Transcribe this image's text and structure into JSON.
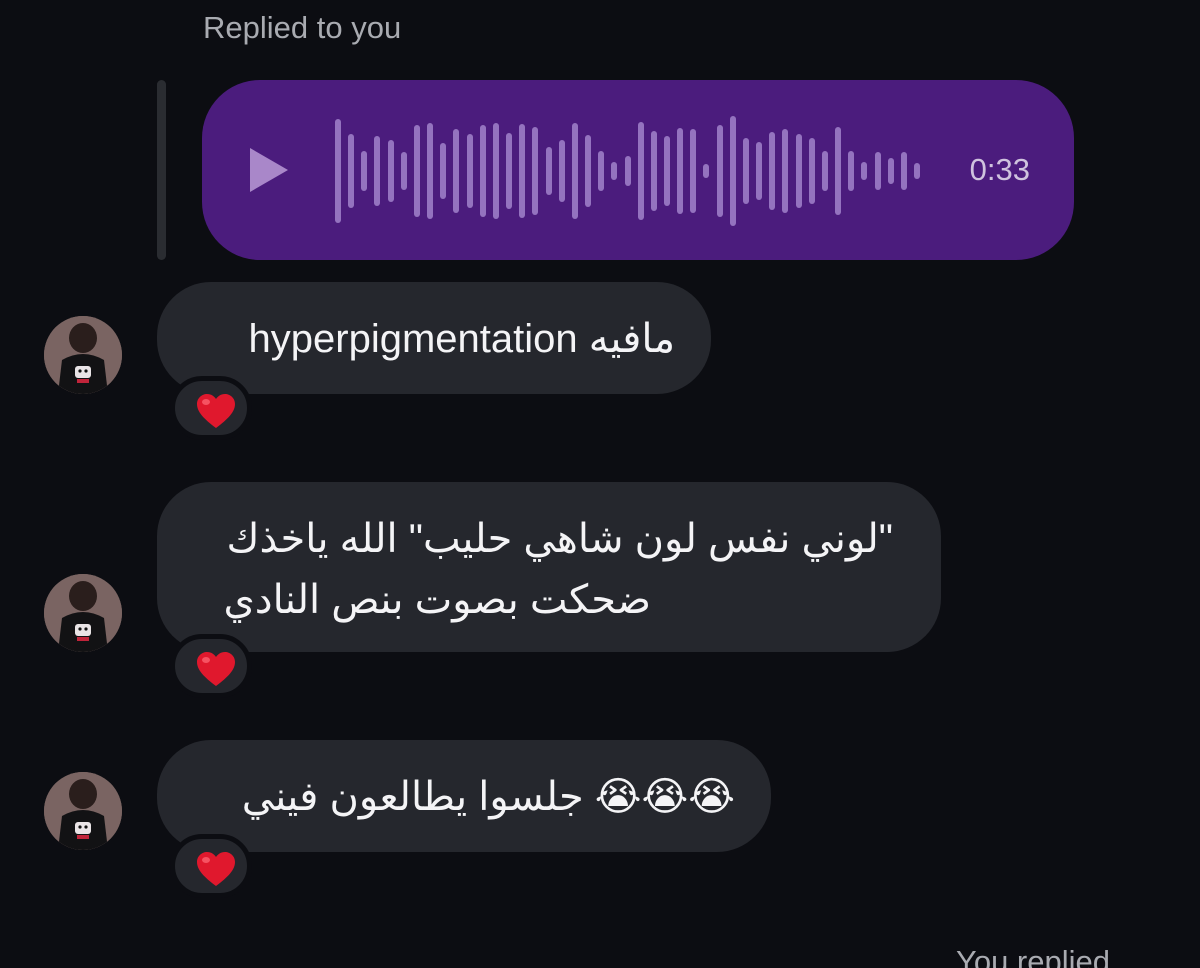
{
  "chat": {
    "reply_label": "Replied to you",
    "voice_message": {
      "duration": "0:33",
      "icon": "play-icon",
      "accent_color": "#4b1c7d"
    },
    "messages": [
      {
        "text": "hyperpigmentation مافيه",
        "reaction": "❤️"
      },
      {
        "lines": [
          "\"لوني نفس لون شاهي حليب\" الله ياخذك",
          "ضحكت بصوت بنص النادي"
        ],
        "reaction": "❤️"
      },
      {
        "text": "جلسوا يطالعون فيني 😭😭😭",
        "reaction": "❤️"
      }
    ],
    "footer_label": "You replied"
  }
}
